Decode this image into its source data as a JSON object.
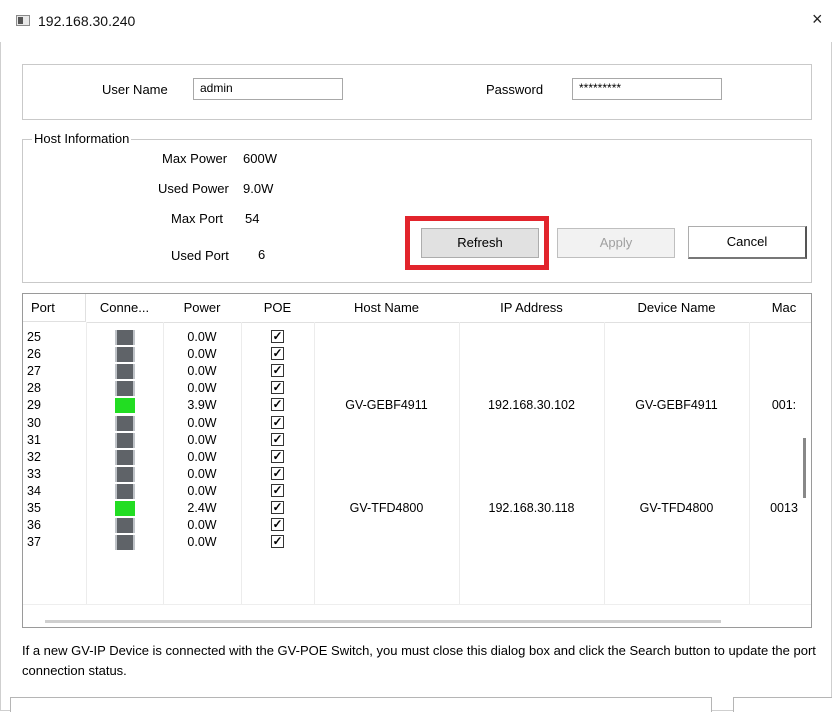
{
  "window": {
    "title": "192.168.30.240",
    "close_glyph": "×"
  },
  "login": {
    "user_name_label": "User Name",
    "user_name_value": "admin",
    "password_label": "Password",
    "password_value": "*********"
  },
  "host_info": {
    "caption": "Host Information",
    "max_power_label": "Max Power",
    "max_power_value": "600W",
    "used_power_label": "Used Power",
    "used_power_value": "9.0W",
    "max_port_label": "Max Port",
    "max_port_value": "54",
    "used_port_label": "Used Port",
    "used_port_value": "6"
  },
  "buttons": {
    "refresh": "Refresh",
    "apply": "Apply",
    "cancel": "Cancel"
  },
  "table": {
    "columns": [
      "Port",
      "Conne...",
      "Power",
      "POE",
      "Host Name",
      "IP Address",
      "Device Name",
      "Mac"
    ],
    "rows": [
      {
        "port": "25",
        "connected": false,
        "power": "0.0W",
        "poe": true,
        "host": "",
        "ip": "",
        "device": "",
        "mac": ""
      },
      {
        "port": "26",
        "connected": false,
        "power": "0.0W",
        "poe": true,
        "host": "",
        "ip": "",
        "device": "",
        "mac": ""
      },
      {
        "port": "27",
        "connected": false,
        "power": "0.0W",
        "poe": true,
        "host": "",
        "ip": "",
        "device": "",
        "mac": ""
      },
      {
        "port": "28",
        "connected": false,
        "power": "0.0W",
        "poe": true,
        "host": "",
        "ip": "",
        "device": "",
        "mac": ""
      },
      {
        "port": "29",
        "connected": true,
        "power": "3.9W",
        "poe": true,
        "host": "GV-GEBF4911",
        "ip": "192.168.30.102",
        "device": "GV-GEBF4911",
        "mac": "001:"
      },
      {
        "port": "30",
        "connected": false,
        "power": "0.0W",
        "poe": true,
        "host": "",
        "ip": "",
        "device": "",
        "mac": ""
      },
      {
        "port": "31",
        "connected": false,
        "power": "0.0W",
        "poe": true,
        "host": "",
        "ip": "",
        "device": "",
        "mac": ""
      },
      {
        "port": "32",
        "connected": false,
        "power": "0.0W",
        "poe": true,
        "host": "",
        "ip": "",
        "device": "",
        "mac": ""
      },
      {
        "port": "33",
        "connected": false,
        "power": "0.0W",
        "poe": true,
        "host": "",
        "ip": "",
        "device": "",
        "mac": ""
      },
      {
        "port": "34",
        "connected": false,
        "power": "0.0W",
        "poe": true,
        "host": "",
        "ip": "",
        "device": "",
        "mac": ""
      },
      {
        "port": "35",
        "connected": true,
        "power": "2.4W",
        "poe": true,
        "host": "GV-TFD4800",
        "ip": "192.168.30.118",
        "device": "GV-TFD4800",
        "mac": "0013"
      },
      {
        "port": "36",
        "connected": false,
        "power": "0.0W",
        "poe": true,
        "host": "",
        "ip": "",
        "device": "",
        "mac": ""
      },
      {
        "port": "37",
        "connected": false,
        "power": "0.0W",
        "poe": true,
        "host": "",
        "ip": "",
        "device": "",
        "mac": ""
      }
    ]
  },
  "note": "If a new GV-IP Device is connected with the GV-POE Switch, you must close this dialog box and click the Search button to update the port connection status.",
  "colors": {
    "highlight": "#e2242c",
    "connected": "#22dd22",
    "disconnected": "#5f6368"
  }
}
